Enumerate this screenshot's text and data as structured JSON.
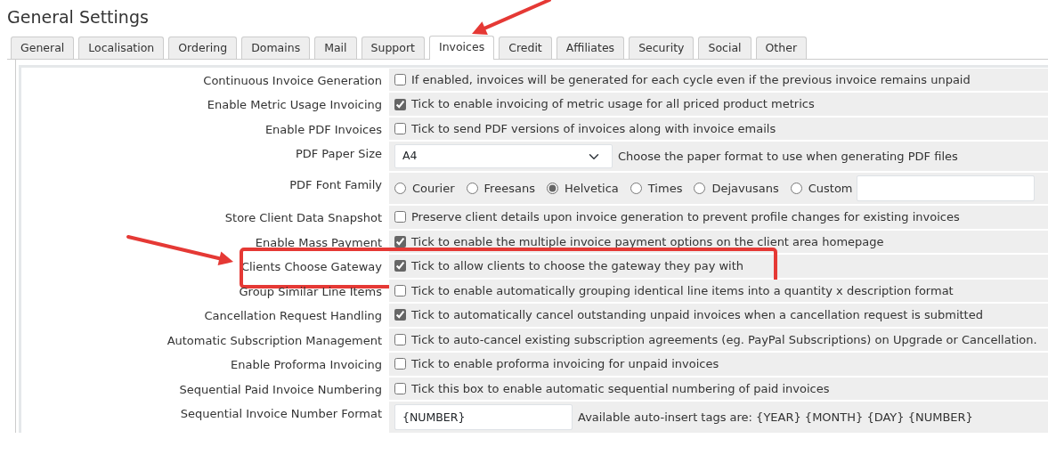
{
  "page_title": "General Settings",
  "tabs": [
    {
      "label": "General",
      "selected": false,
      "pointed": false
    },
    {
      "label": "Localisation",
      "selected": false,
      "pointed": false
    },
    {
      "label": "Ordering",
      "selected": false,
      "pointed": false
    },
    {
      "label": "Domains",
      "selected": false,
      "pointed": false
    },
    {
      "label": "Mail",
      "selected": false,
      "pointed": false
    },
    {
      "label": "Support",
      "selected": false,
      "pointed": false
    },
    {
      "label": "Invoices",
      "selected": true,
      "pointed": true
    },
    {
      "label": "Credit",
      "selected": false,
      "pointed": false
    },
    {
      "label": "Affiliates",
      "selected": false,
      "pointed": false
    },
    {
      "label": "Security",
      "selected": false,
      "pointed": false
    },
    {
      "label": "Social",
      "selected": false,
      "pointed": false
    },
    {
      "label": "Other",
      "selected": false,
      "pointed": false
    }
  ],
  "settings": [
    {
      "kind": "checkbox",
      "label": "Continuous Invoice Generation",
      "checked": false,
      "description": "If enabled, invoices will be generated for each cycle even if the previous invoice remains unpaid",
      "highlighted": false
    },
    {
      "kind": "checkbox",
      "label": "Enable Metric Usage Invoicing",
      "checked": true,
      "description": "Tick to enable invoicing of metric usage for all priced product metrics",
      "highlighted": false
    },
    {
      "kind": "checkbox",
      "label": "Enable PDF Invoices",
      "checked": false,
      "description": "Tick to send PDF versions of invoices along with invoice emails",
      "highlighted": false
    },
    {
      "kind": "select",
      "label": "PDF Paper Size",
      "value": "A4",
      "description": "Choose the paper format to use when generating PDF files",
      "highlighted": false
    },
    {
      "kind": "radio",
      "label": "PDF Font Family",
      "options": [
        {
          "label": "Courier",
          "selected": false
        },
        {
          "label": "Freesans",
          "selected": false
        },
        {
          "label": "Helvetica",
          "selected": true
        },
        {
          "label": "Times",
          "selected": false
        },
        {
          "label": "Dejavusans",
          "selected": false
        },
        {
          "label": "Custom",
          "selected": false
        }
      ],
      "custom_input": true,
      "highlighted": false
    },
    {
      "kind": "checkbox",
      "label": "Store Client Data Snapshot",
      "checked": false,
      "description": "Preserve client details upon invoice generation to prevent profile changes for existing invoices",
      "highlighted": false
    },
    {
      "kind": "checkbox",
      "label": "Enable Mass Payment",
      "checked": true,
      "description": "Tick to enable the multiple invoice payment options on the client area homepage",
      "highlighted": false
    },
    {
      "kind": "checkbox",
      "label": "Clients Choose Gateway",
      "checked": true,
      "description": "Tick to allow clients to choose the gateway they pay with",
      "highlighted": true
    },
    {
      "kind": "checkbox",
      "label": "Group Similar Line Items",
      "checked": false,
      "description": "Tick to enable automatically grouping identical line items into a quantity x description format",
      "highlighted": false
    },
    {
      "kind": "checkbox",
      "label": "Cancellation Request Handling",
      "checked": true,
      "description": "Tick to automatically cancel outstanding unpaid invoices when a cancellation request is submitted",
      "highlighted": false
    },
    {
      "kind": "checkbox",
      "label": "Automatic Subscription Management",
      "checked": false,
      "description": "Tick to auto-cancel existing subscription agreements (eg. PayPal Subscriptions) on Upgrade or Cancellation.",
      "highlighted": false
    },
    {
      "kind": "checkbox",
      "label": "Enable Proforma Invoicing",
      "checked": false,
      "description": "Tick to enable proforma invoicing for unpaid invoices",
      "highlighted": false
    },
    {
      "kind": "checkbox",
      "label": "Sequential Paid Invoice Numbering",
      "checked": false,
      "description": "Tick this box to enable automatic sequential numbering of paid invoices",
      "highlighted": false
    },
    {
      "kind": "text",
      "label": "Sequential Invoice Number Format",
      "value": "{NUMBER}",
      "description": "Available auto-insert tags are: {YEAR} {MONTH} {DAY} {NUMBER}",
      "highlighted": false
    }
  ]
}
